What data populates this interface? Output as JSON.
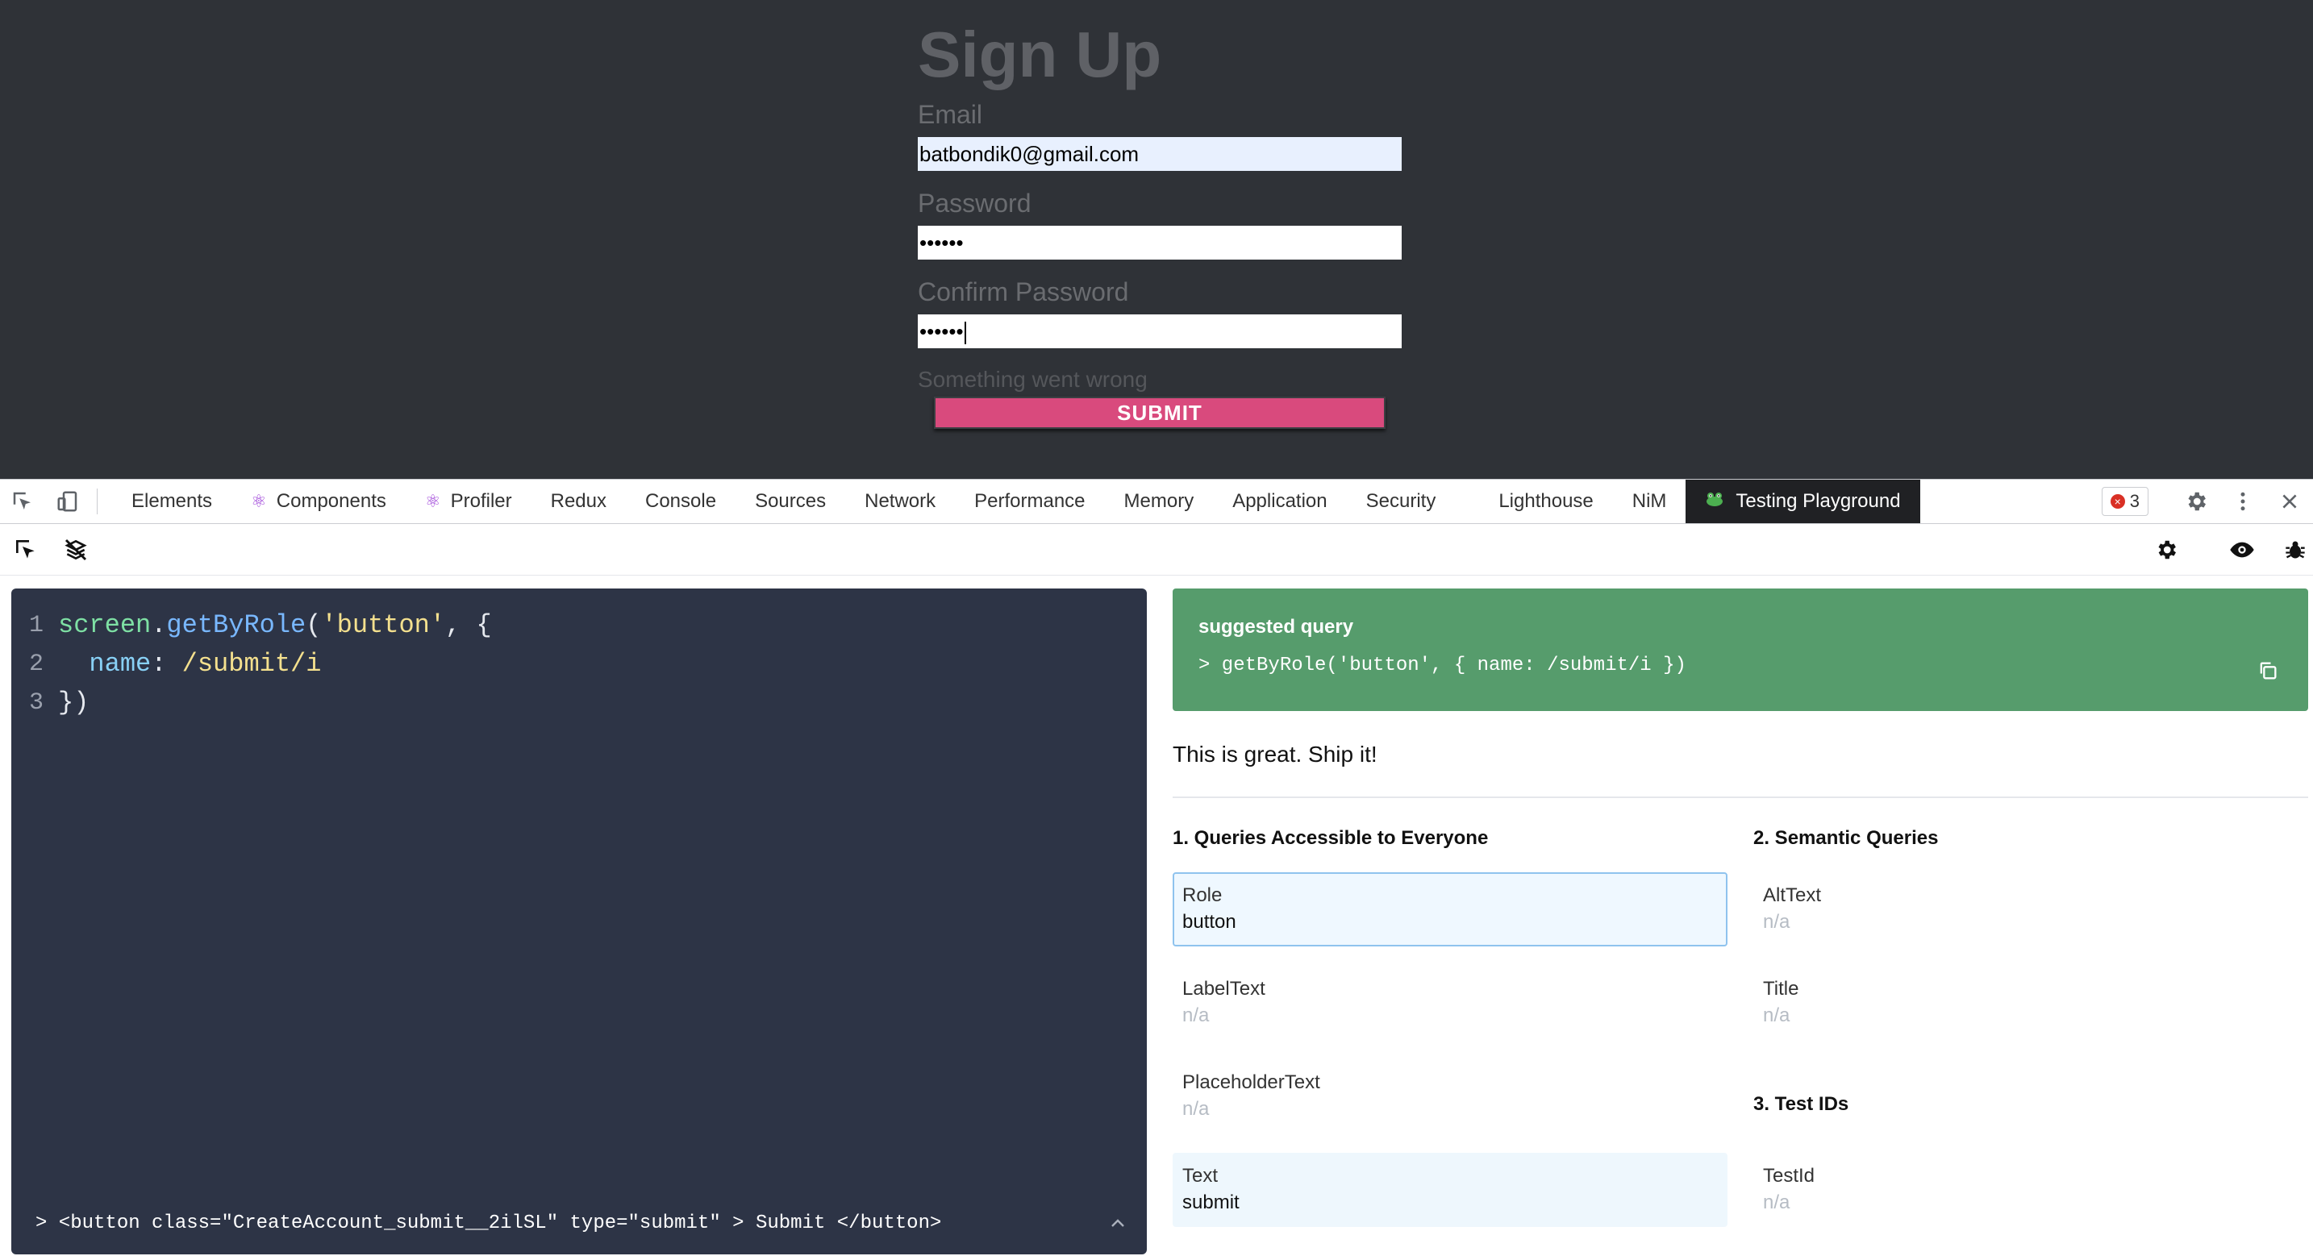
{
  "form": {
    "title": "Sign Up",
    "email_label": "Email",
    "email_value": "batbondik0@gmail.com",
    "password_label": "Password",
    "password_value": "••••••",
    "confirm_label": "Confirm Password",
    "confirm_value": "••••••",
    "error_text": "Something went wrong",
    "submit_label": "SUBMIT"
  },
  "devtools": {
    "tabs": [
      {
        "label": "Elements"
      },
      {
        "label": "Components",
        "icon": "react-icon"
      },
      {
        "label": "Profiler",
        "icon": "react-icon"
      },
      {
        "label": "Redux"
      },
      {
        "label": "Console"
      },
      {
        "label": "Sources"
      },
      {
        "label": "Network"
      },
      {
        "label": "Performance"
      },
      {
        "label": "Memory"
      },
      {
        "label": "Application"
      },
      {
        "label": "Security"
      },
      {
        "label": "Lighthouse"
      },
      {
        "label": "NiM"
      },
      {
        "label": "Testing Playground",
        "icon": "frog-icon",
        "active": true
      }
    ],
    "error_count": "3"
  },
  "editor": {
    "line_numbers": [
      "1",
      "2",
      "3"
    ],
    "line1": {
      "obj": "screen",
      "dot": ".",
      "fn": "getByRole",
      "open": "(",
      "str": "'button'",
      "rest": ", {"
    },
    "line2": {
      "indent": "  ",
      "key": "name",
      "colon": ": ",
      "regex": "/submit/i"
    },
    "line3": {
      "close": "})"
    },
    "result": "> <button class=\"CreateAccount_submit__2ilSL\" type=\"submit\" > Submit </button>"
  },
  "suggestion": {
    "title": "suggested query",
    "query": "> getByRole('button', { name: /submit/i })",
    "verdict": "This is great. Ship it!"
  },
  "queries": {
    "section1": "1. Queries Accessible to Everyone",
    "section2": "2. Semantic Queries",
    "section3": "3. Test IDs",
    "role": {
      "name": "Role",
      "value": "button"
    },
    "label_text": {
      "name": "LabelText",
      "value": "n/a"
    },
    "placeholder_text": {
      "name": "PlaceholderText",
      "value": "n/a"
    },
    "text": {
      "name": "Text",
      "value": "submit"
    },
    "alt_text": {
      "name": "AltText",
      "value": "n/a"
    },
    "title": {
      "name": "Title",
      "value": "n/a"
    },
    "test_id": {
      "name": "TestId",
      "value": "n/a"
    }
  },
  "colors": {
    "page_bg": "#2f3237",
    "submit_bg": "#d94a7d",
    "editor_bg": "#2d3446",
    "suggestion_bg": "#569c6c",
    "active_tab_bg": "#202124"
  }
}
